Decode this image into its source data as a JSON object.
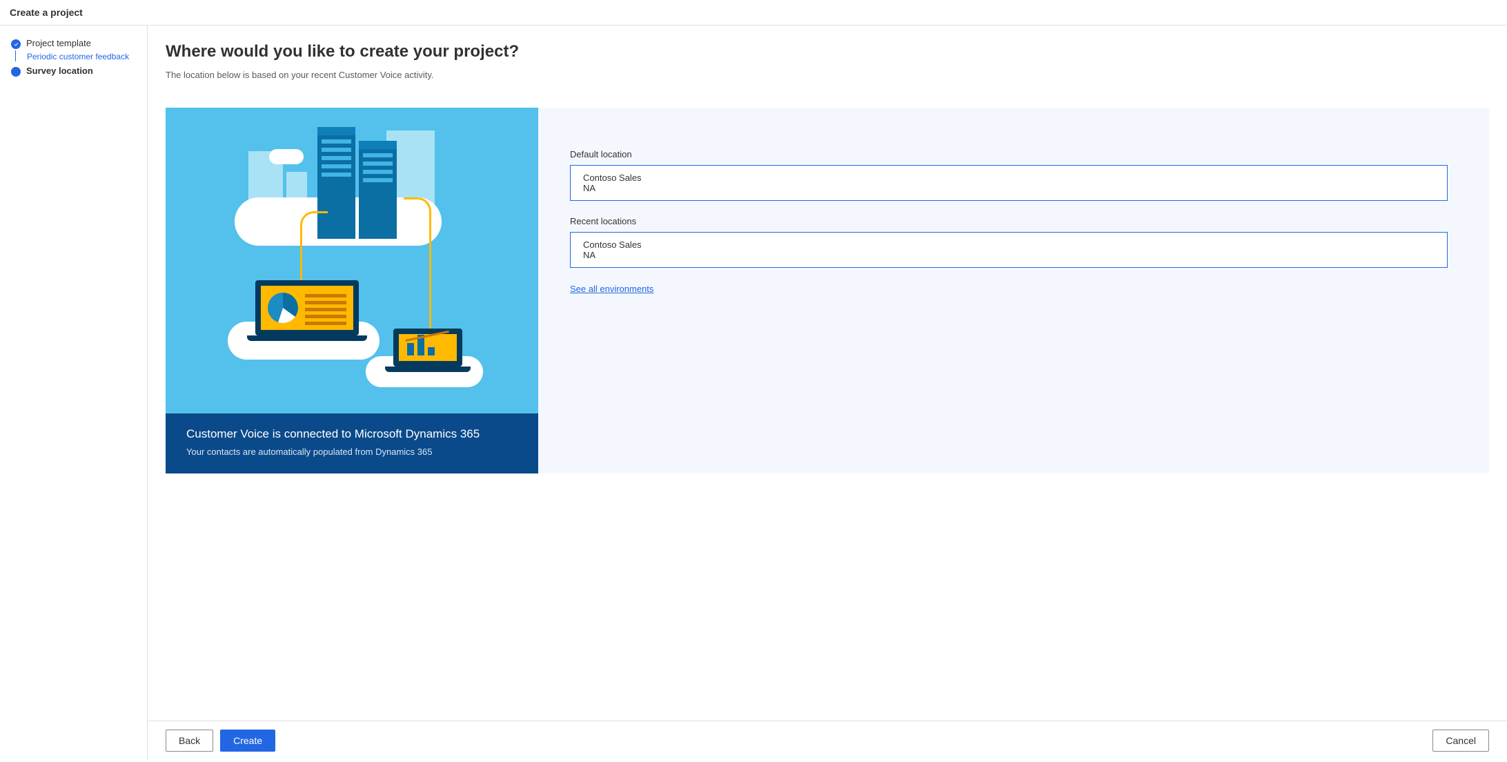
{
  "header": {
    "title": "Create a project"
  },
  "steps": {
    "template": {
      "label": "Project template",
      "sublink": "Periodic customer feedback"
    },
    "location": {
      "label": "Survey location"
    }
  },
  "main": {
    "heading": "Where would you like to create your project?",
    "subtitle": "The location below is based on your recent Customer Voice activity."
  },
  "illustration": {
    "card_title": "Customer Voice is connected to Microsoft Dynamics 365",
    "card_sub": "Your contacts are automatically populated from Dynamics 365"
  },
  "locations": {
    "default_label": "Default location",
    "default": {
      "name": "Contoso Sales",
      "region": "NA"
    },
    "recent_label": "Recent locations",
    "recent": [
      {
        "name": "Contoso Sales",
        "region": "NA"
      }
    ],
    "see_all": "See all environments"
  },
  "footer": {
    "back": "Back",
    "create": "Create",
    "cancel": "Cancel"
  }
}
